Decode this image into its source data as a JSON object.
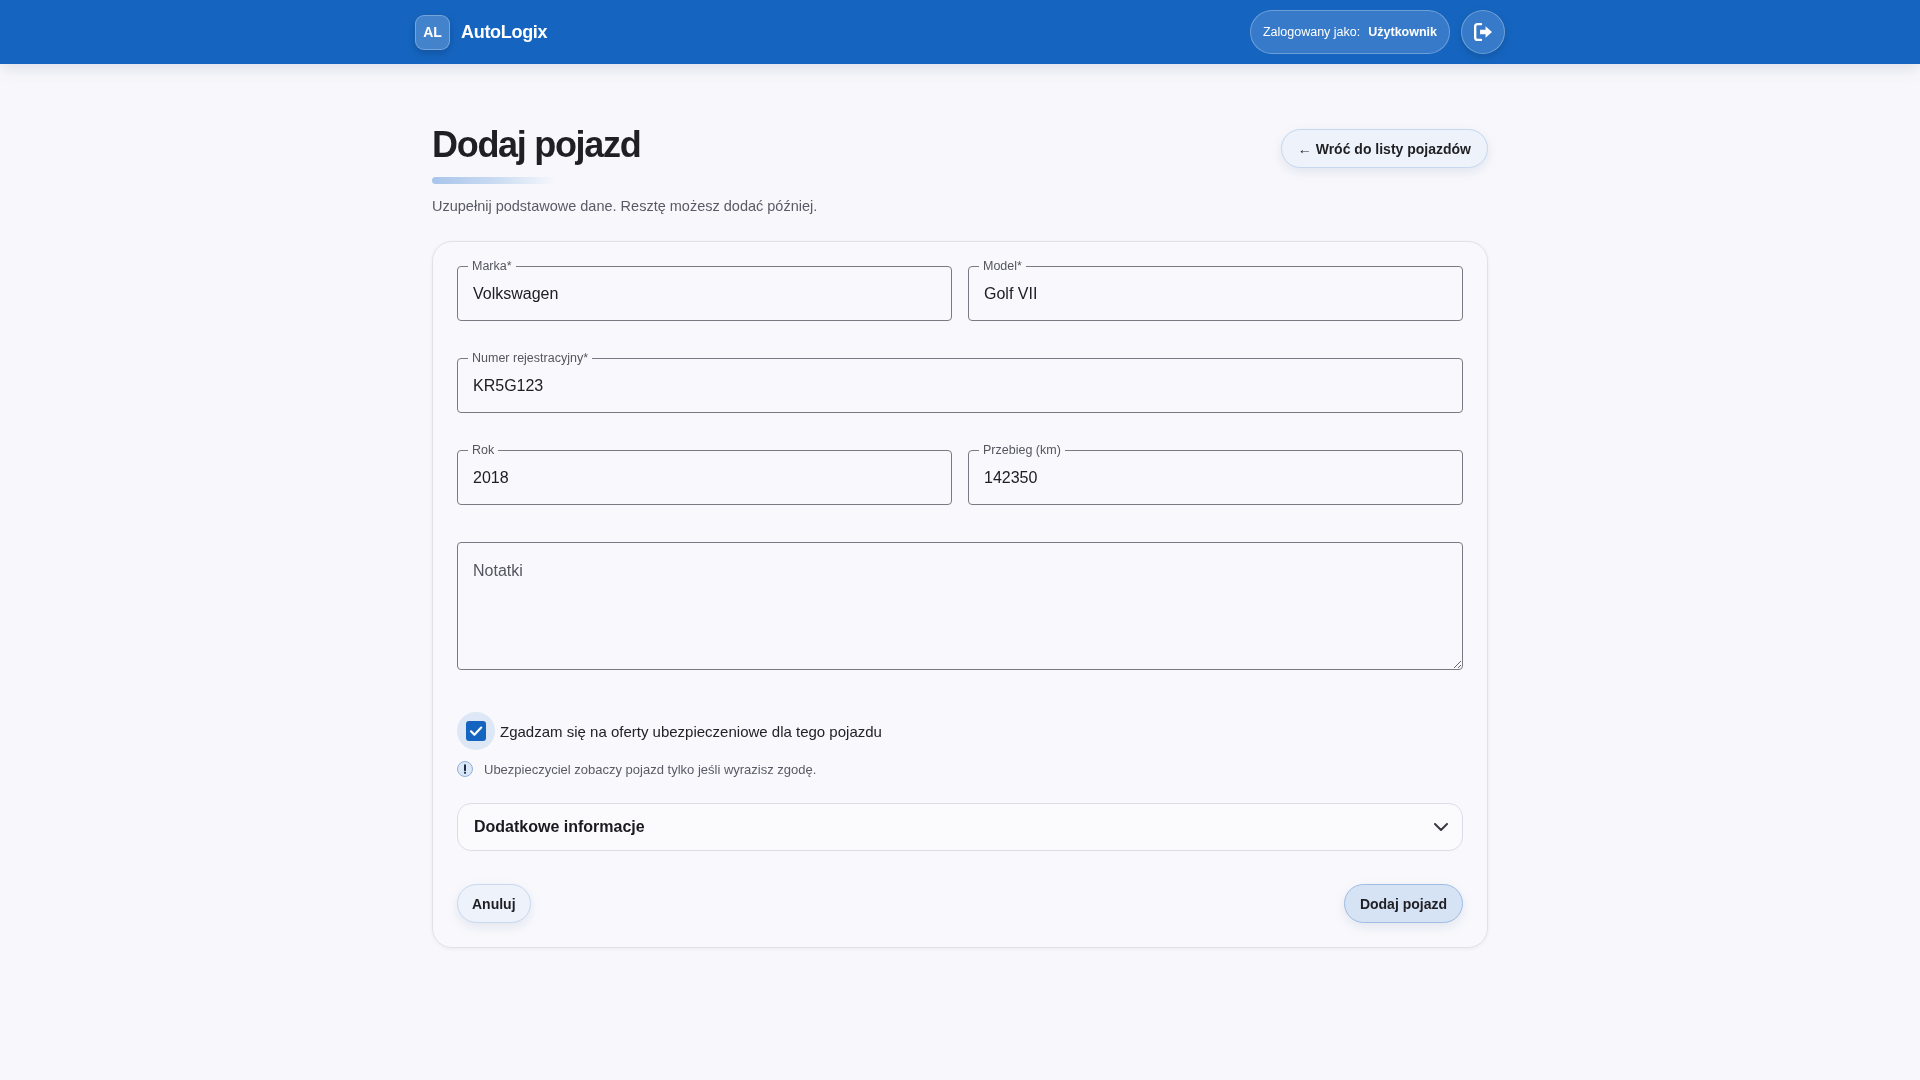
{
  "header": {
    "logo": "AL",
    "brand": "AutoLogix",
    "user": {
      "label": "Zalogowany jako:",
      "name": "Użytkownik"
    }
  },
  "page": {
    "title": "Dodaj pojazd",
    "subtitle": "Uzupełnij podstawowe dane. Resztę możesz dodać później.",
    "back_button": "← Wróć do listy pojazdów"
  },
  "form": {
    "rows": [
      {
        "fields": [
          {
            "label": "Marka*",
            "value": "Volkswagen"
          },
          {
            "label": "Model*",
            "value": "Golf VII"
          }
        ]
      },
      {
        "fields": [
          {
            "label": "Numer rejestracyjny*",
            "value": "KR5G123"
          }
        ]
      },
      {
        "fields": [
          {
            "label": "Rok",
            "value": "2018"
          },
          {
            "label": "Przebieg (km)",
            "value": "142350"
          }
        ]
      }
    ],
    "notes": {
      "placeholder": "Notatki"
    },
    "consent": {
      "label": "Zgadzam się na oferty ubezpieczeniowe dla tego pojazdu",
      "checked": true
    },
    "hint": "Ubezpieczyciel zobaczy pojazd tylko jeśli wyrazisz zgodę.",
    "accordion": {
      "title": "Dodatkowe informacje",
      "expanded": false
    },
    "actions": [
      {
        "label": "Anuluj",
        "kind": "secondary"
      },
      {
        "label": "Dodaj pojazd",
        "kind": "primary"
      }
    ]
  }
}
